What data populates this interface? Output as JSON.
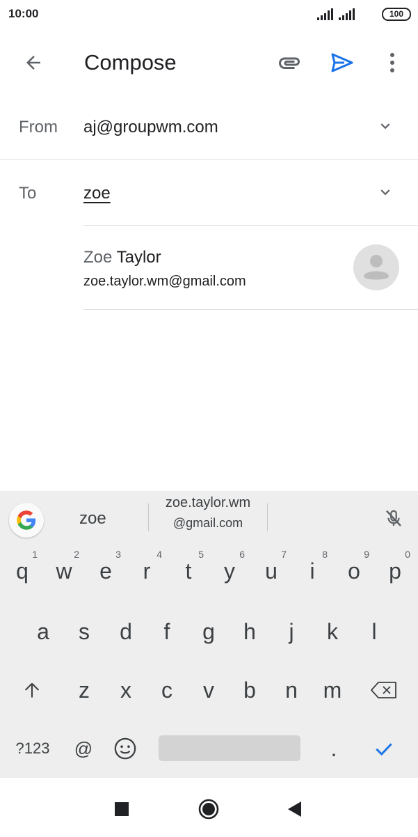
{
  "status_bar": {
    "time": "10:00",
    "battery": "100"
  },
  "app_bar": {
    "title": "Compose"
  },
  "from": {
    "label": "From",
    "value": "aj@groupwm.com"
  },
  "to": {
    "label": "To",
    "value": "zoe"
  },
  "suggestion": {
    "first_name": "Zoe",
    "last_name": " Taylor",
    "email": "zoe.taylor.wm@gmail.com"
  },
  "keyboard": {
    "suggestions": {
      "left": "zoe",
      "center_line1": "zoe.taylor.wm",
      "center_line2": "@gmail.com"
    },
    "row1": [
      {
        "key": "q",
        "hint": "1"
      },
      {
        "key": "w",
        "hint": "2"
      },
      {
        "key": "e",
        "hint": "3"
      },
      {
        "key": "r",
        "hint": "4"
      },
      {
        "key": "t",
        "hint": "5"
      },
      {
        "key": "y",
        "hint": "6"
      },
      {
        "key": "u",
        "hint": "7"
      },
      {
        "key": "i",
        "hint": "8"
      },
      {
        "key": "o",
        "hint": "9"
      },
      {
        "key": "p",
        "hint": "0"
      }
    ],
    "row2": [
      "a",
      "s",
      "d",
      "f",
      "g",
      "h",
      "j",
      "k",
      "l"
    ],
    "row3": [
      "z",
      "x",
      "c",
      "v",
      "b",
      "n",
      "m"
    ],
    "bottom": {
      "symbols": "?123",
      "at": "@",
      "period": "."
    }
  },
  "colors": {
    "accent": "#1a73e8",
    "text": "#202124",
    "secondary": "#5f6368",
    "keyboard_bg": "#eeeeee"
  }
}
